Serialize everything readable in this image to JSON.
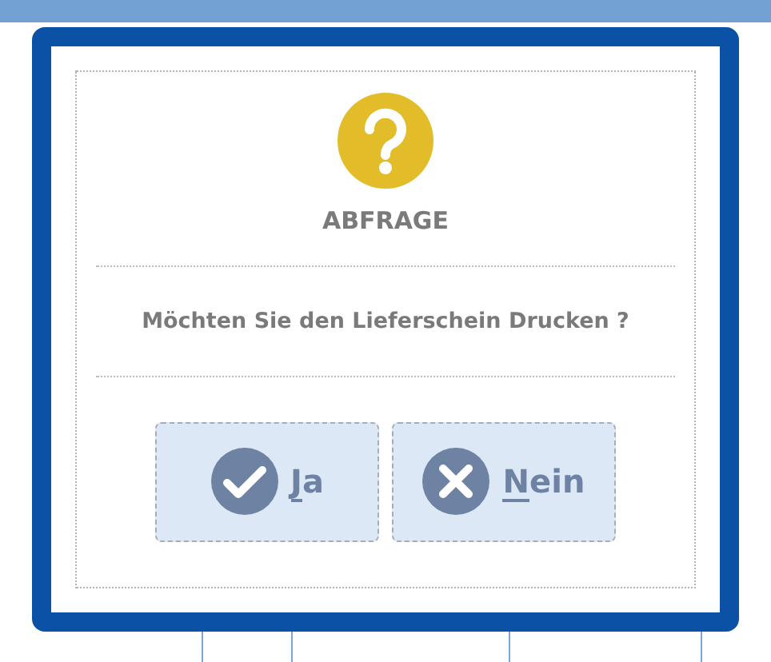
{
  "dialog": {
    "kind": "question",
    "title": "ABFRAGE",
    "message": "Möchten Sie den Lieferschein Drucken ?"
  },
  "buttons": [
    {
      "label": "Ja",
      "kind": "check",
      "underline_first": true
    },
    {
      "label": "Nein",
      "kind": "cross",
      "underline_first": true
    }
  ]
}
